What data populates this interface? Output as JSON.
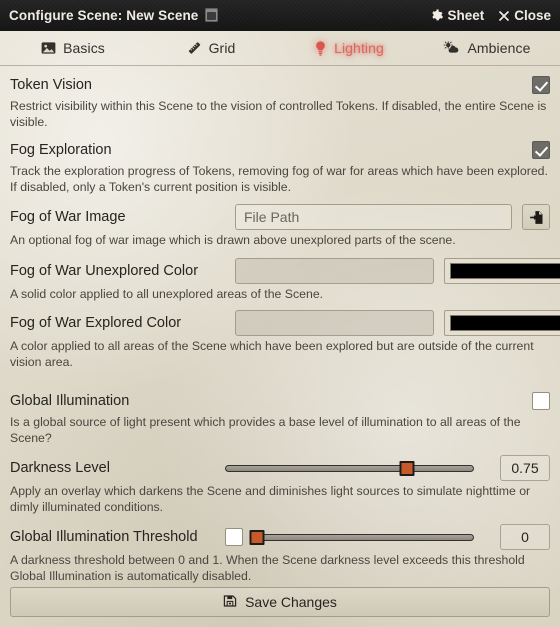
{
  "window": {
    "title": "Configure Scene: New Scene",
    "title_icon": "scene-document-icon",
    "actions": [
      {
        "label": "Sheet",
        "icon": "gear-icon"
      },
      {
        "label": "Close",
        "icon": "close-x-icon"
      }
    ]
  },
  "tabs": [
    {
      "label": "Basics",
      "icon": "image-icon",
      "active": false
    },
    {
      "label": "Grid",
      "icon": "ruler-icon",
      "active": false
    },
    {
      "label": "Lighting",
      "icon": "lightbulb-icon",
      "active": true
    },
    {
      "label": "Ambience",
      "icon": "cloud-sun-icon",
      "active": false
    }
  ],
  "fields": {
    "token_vision": {
      "label": "Token Vision",
      "hint": "Restrict visibility within this Scene to the vision of controlled Tokens. If disabled, the entire Scene is visible.",
      "checked": true
    },
    "fog_exploration": {
      "label": "Fog Exploration",
      "hint": "Track the exploration progress of Tokens, removing fog of war for areas which have been explored. If disabled, only a Token's current position is visible.",
      "checked": true
    },
    "fog_of_war_image": {
      "label": "Fog of War Image",
      "value": "",
      "placeholder": "File Path",
      "hint": "An optional fog of war image which is drawn above unexplored parts of the scene.",
      "picker_icon": "file-import-icon"
    },
    "fog_unexplored_color": {
      "label": "Fog of War Unexplored Color",
      "value": "",
      "placeholder": "",
      "swatch_color": "#000000",
      "hint": "A solid color applied to all unexplored areas of the Scene."
    },
    "fog_explored_color": {
      "label": "Fog of War Explored Color",
      "value": "",
      "placeholder": "",
      "swatch_color": "#000000",
      "hint": "A color applied to all areas of the Scene which have been explored but are outside of the current vision area."
    },
    "global_illumination": {
      "label": "Global Illumination",
      "hint": "Is a global source of light present which provides a base level of illumination to all areas of the Scene?",
      "checked": false
    },
    "darkness_level": {
      "label": "Darkness Level",
      "value": "0.75",
      "percent": 73,
      "min": 0,
      "max": 1,
      "hint": "Apply an overlay which darkens the Scene and diminishes light sources to simulate nighttime or dimly illuminated conditions."
    },
    "global_illumination_threshold": {
      "label": "Global Illumination Threshold",
      "value": "0",
      "percent": 0,
      "min": 0,
      "max": 1,
      "checked": false,
      "hint": "A darkness threshold between 0 and 1. When the Scene darkness level exceeds this threshold Global Illumination is automatically disabled."
    }
  },
  "footer": {
    "save_label": "Save Changes",
    "save_icon": "floppy-save-icon"
  },
  "colors": {
    "accent": "#d9695f",
    "slider_thumb": "#c65a2b",
    "header_bg": "#1b1b1b",
    "body_bg": "#ded9c9"
  }
}
